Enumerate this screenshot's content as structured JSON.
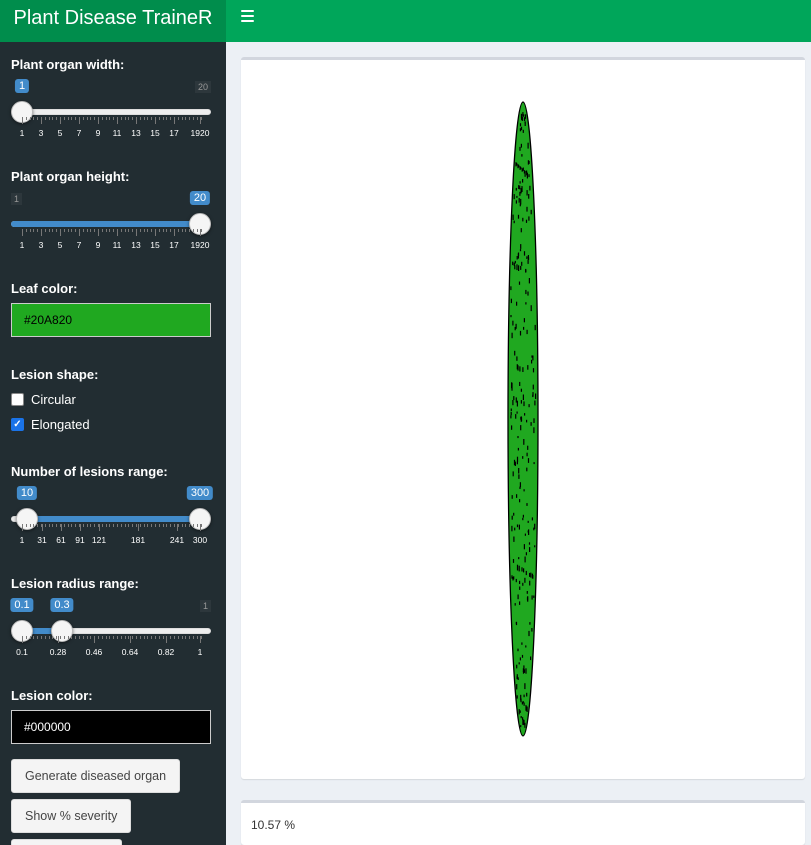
{
  "app": {
    "title": "Plant Disease TraineR"
  },
  "header": {
    "menu_icon": "hamburger-icon"
  },
  "sidebar": {
    "organ_width": {
      "label": "Plant organ width:",
      "min": 1,
      "max": 20,
      "value": 1,
      "min_label": "1",
      "max_label": "20",
      "value_label": "1",
      "ticks": [
        "1",
        "3",
        "5",
        "7",
        "9",
        "11",
        "13",
        "15",
        "17",
        "1920"
      ]
    },
    "organ_height": {
      "label": "Plant organ height:",
      "min": 1,
      "max": 20,
      "value": 20,
      "min_label": "1",
      "max_label": "20",
      "value_label": "20",
      "ticks": [
        "1",
        "3",
        "5",
        "7",
        "9",
        "11",
        "13",
        "15",
        "17",
        "1920"
      ]
    },
    "leaf_color": {
      "label": "Leaf color:",
      "value": "#20A820"
    },
    "lesion_shape": {
      "label": "Lesion shape:",
      "options": [
        {
          "label": "Circular",
          "checked": false
        },
        {
          "label": "Elongated",
          "checked": true
        }
      ]
    },
    "lesions_range": {
      "label": "Number of lesions range:",
      "min": 1,
      "max": 300,
      "from": 10,
      "to": 300,
      "from_label": "10",
      "to_label": "300",
      "ticks": [
        "1",
        "31",
        "61",
        "91",
        "121",
        "181",
        "241",
        "300"
      ]
    },
    "radius_range": {
      "label": "Lesion radius range:",
      "min": 0.1,
      "max": 1,
      "from": 0.1,
      "to": 0.3,
      "from_label": "0.1",
      "to_label": "0.3",
      "max_label": "1",
      "ticks": [
        "0.1",
        "0.28",
        "0.46",
        "0.64",
        "0.82",
        "1"
      ]
    },
    "lesion_color": {
      "label": "Lesion color:",
      "value": "#000000"
    },
    "buttons": {
      "generate": "Generate diseased organ",
      "severity": "Show % severity"
    }
  },
  "main": {
    "severity_text": "10.57 %"
  },
  "colors": {
    "header": "#00a65a",
    "logo": "#008d4c",
    "sidebar": "#222d32",
    "slider": "#428bca",
    "leaf": "#20a820",
    "lesion": "#000000"
  }
}
